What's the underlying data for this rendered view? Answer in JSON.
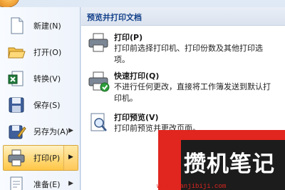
{
  "left_menu": {
    "items": [
      {
        "label": "新建(N)",
        "icon": "new-document-icon",
        "has_submenu": false
      },
      {
        "label": "打开(O)",
        "icon": "open-folder-icon",
        "has_submenu": false
      },
      {
        "label": "转换(V)",
        "icon": "convert-icon",
        "has_submenu": false
      },
      {
        "label": "保存(S)",
        "icon": "save-icon",
        "has_submenu": false
      },
      {
        "label": "另存为(A)",
        "icon": "save-as-icon",
        "has_submenu": true
      },
      {
        "label": "打印(P)",
        "icon": "printer-icon",
        "has_submenu": true,
        "selected": true
      },
      {
        "label": "准备(E)",
        "icon": "prepare-icon",
        "has_submenu": true
      }
    ]
  },
  "print_panel": {
    "title": "预览并打印文档",
    "options": [
      {
        "title": "打印(P)",
        "description": "打印前选择打印机、打印份数及其他打印选项。",
        "icon": "printer-icon"
      },
      {
        "title": "快速打印(Q)",
        "description": "不进行任何更改，直接将工作簿发送到默认打印机。",
        "icon": "quick-print-icon"
      },
      {
        "title": "打印预览(V)",
        "description": "打印前预览并更改页面。",
        "icon": "print-preview-icon"
      }
    ]
  },
  "watermark": {
    "text": "攒机笔记",
    "url": "www.cuanjibiji.com"
  },
  "colors": {
    "selection": "#ffd977",
    "panel_title": "#15428b",
    "watermark_red": "#e0261f"
  }
}
